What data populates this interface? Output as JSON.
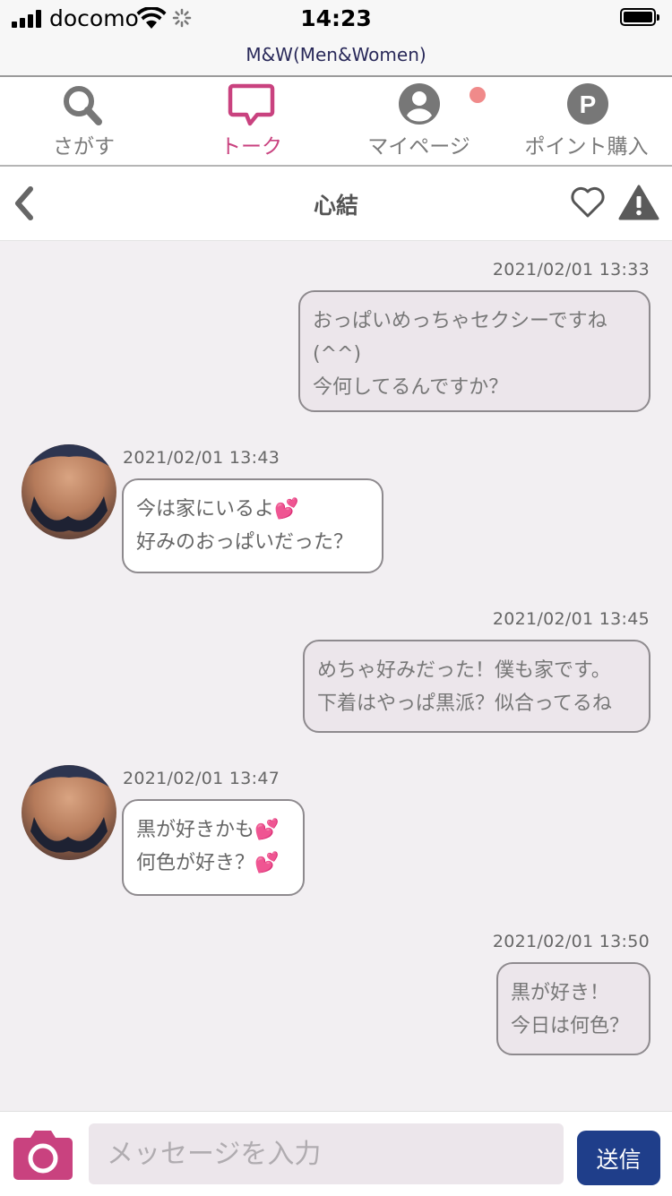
{
  "status_bar": {
    "carrier": "docomo",
    "time": "14:23"
  },
  "site_title": "M&W(Men&Women)",
  "nav": {
    "tabs": [
      {
        "label": "さがす",
        "icon": "search-icon"
      },
      {
        "label": "トーク",
        "icon": "chat-bubble-icon",
        "active": true
      },
      {
        "label": "マイページ",
        "icon": "user-icon",
        "badge": true
      },
      {
        "label": "ポイント購入",
        "icon": "points-p-icon"
      }
    ],
    "active_color": "#c9427f"
  },
  "chat": {
    "partner_name": "心結",
    "messages": [
      {
        "side": "out",
        "time": "2021/02/01 13:33",
        "lines": [
          "おっぱいめっちゃセクシーですね",
          "(^^)",
          "今何してるんですか？"
        ]
      },
      {
        "side": "in",
        "time": "2021/02/01 13:43",
        "lines": [
          "今は家にいるよ💕",
          "好みのおっぱいだった？"
        ]
      },
      {
        "side": "out",
        "time": "2021/02/01 13:45",
        "lines": [
          "めちゃ好みだった！僕も家です。",
          "下着はやっぱ黒派？似合ってるね"
        ]
      },
      {
        "side": "in",
        "time": "2021/02/01 13:47",
        "lines": [
          "黒が好きかも💕",
          "何色が好き？💕"
        ]
      },
      {
        "side": "out",
        "time": "2021/02/01 13:50",
        "lines": [
          "黒が好き！",
          "今日は何色？"
        ]
      }
    ]
  },
  "composer": {
    "placeholder": "メッセージを入力",
    "send_label": "送信",
    "send_color": "#1f3e8a",
    "camera_color": "#c9427f"
  }
}
